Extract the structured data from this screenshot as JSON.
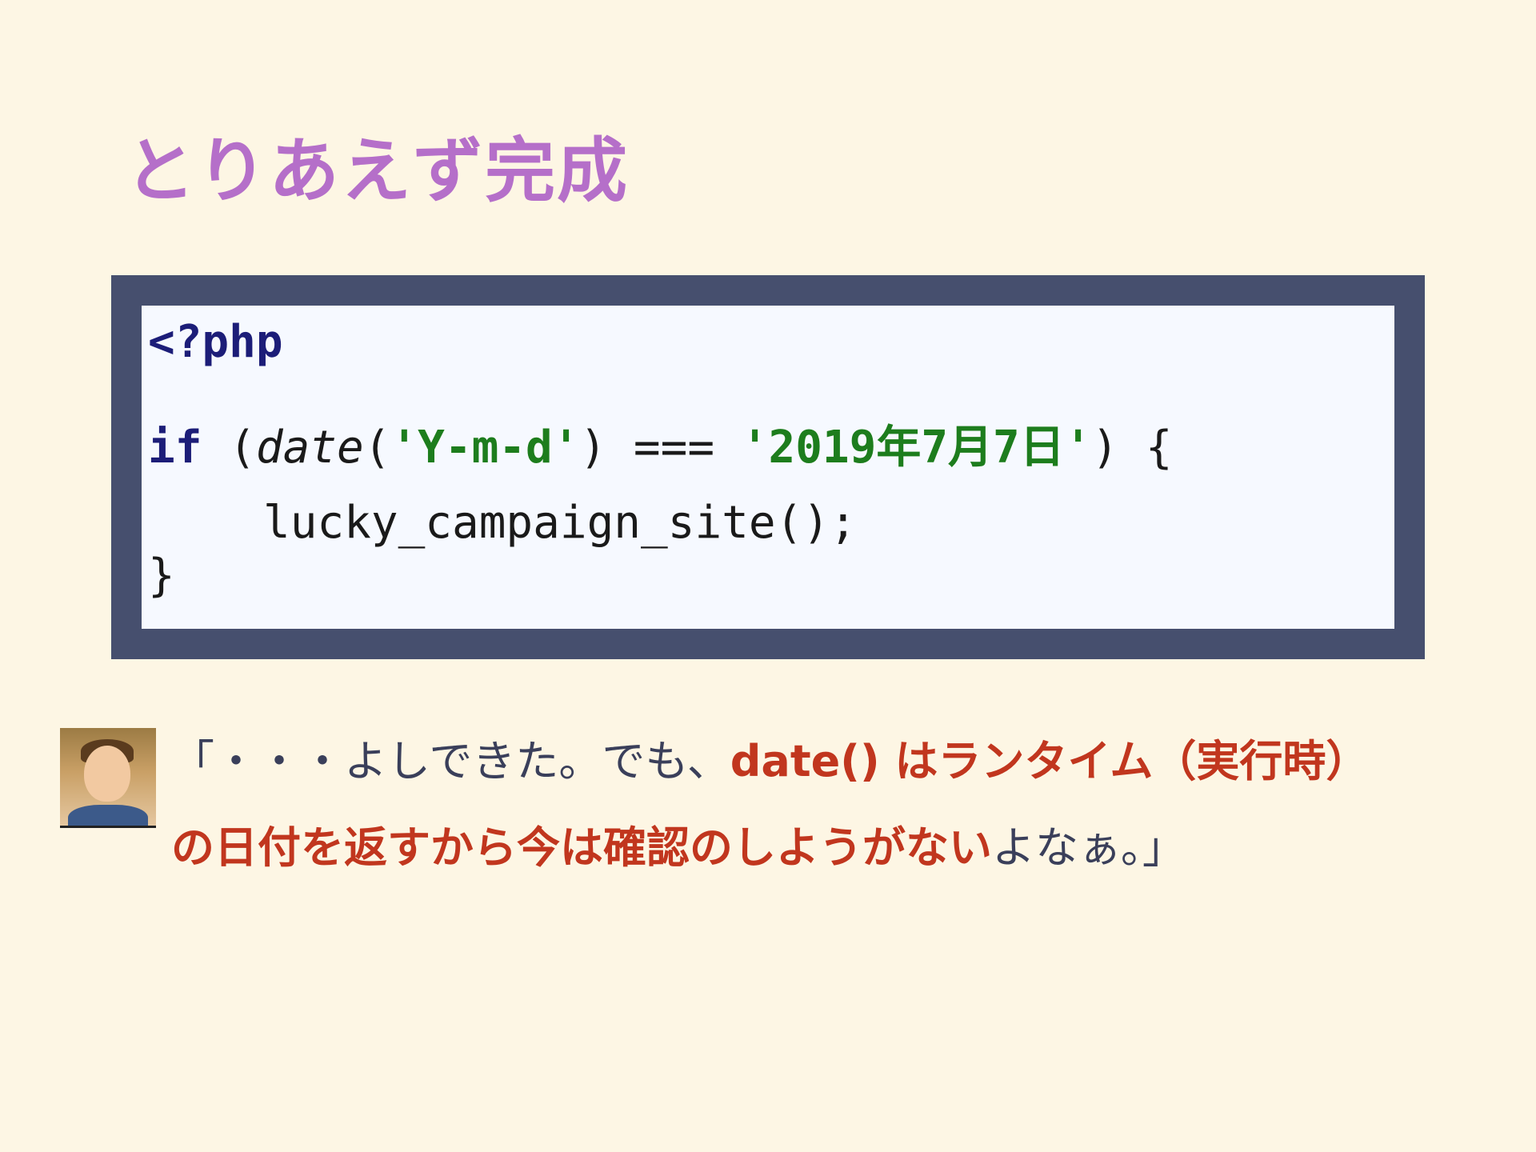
{
  "slide": {
    "title": "とりあえず完成"
  },
  "code": {
    "line1_tag": "<?php",
    "line2_if": "if",
    "line2_paren_open": " (",
    "line2_fn": "date",
    "line2_call_open": "(",
    "line2_str1": "'Y-m-d'",
    "line2_middle": ") === ",
    "line2_str2": "'2019年7月7日'",
    "line2_end": ") {",
    "line3": "lucky_campaign_site();",
    "line4": "}"
  },
  "comment": {
    "text_plain": "「・・・よしできた。でも、",
    "text_highlight": "date() はランタイム（実行時）の日付を返すから今は確認のしようがない",
    "text_end": "よなぁ。」"
  },
  "colors": {
    "background": "#fdf6e4",
    "title": "#b56fc9",
    "code_frame": "#464f6e",
    "code_bg": "#f6f9ff",
    "keyword": "#1c1d78",
    "string": "#1d7d1d",
    "highlight": "#c1361e",
    "text": "#3a3f5a"
  },
  "avatar": {
    "icon": "person-photo-icon"
  }
}
